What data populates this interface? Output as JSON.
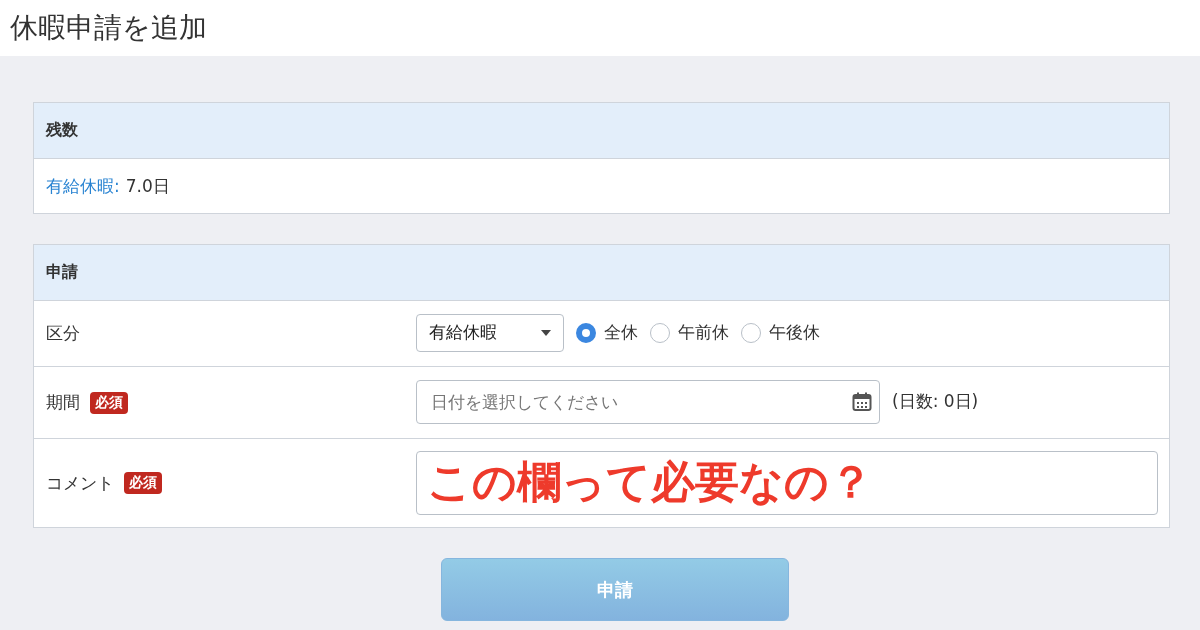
{
  "page": {
    "title": "休暇申請を追加"
  },
  "balance": {
    "heading": "残数",
    "items": [
      {
        "label": "有給休暇:",
        "value": "7.0日"
      }
    ]
  },
  "form": {
    "heading": "申請",
    "rows": [
      {
        "kind": "type",
        "label": "区分",
        "required": false,
        "select": {
          "value": "有給休暇"
        },
        "options": [
          {
            "label": "全休",
            "selected": true
          },
          {
            "label": "午前休",
            "selected": false
          },
          {
            "label": "午後休",
            "selected": false
          }
        ]
      },
      {
        "kind": "date",
        "label": "期間",
        "required": true,
        "badge": "必須",
        "placeholder": "日付を選択してください",
        "note": "(日数: 0日)"
      },
      {
        "kind": "comment",
        "label": "コメント",
        "required": true,
        "badge": "必須",
        "annotation": "この欄って必要なの？"
      }
    ],
    "submit": {
      "label": "申請",
      "disabled": true
    }
  }
}
